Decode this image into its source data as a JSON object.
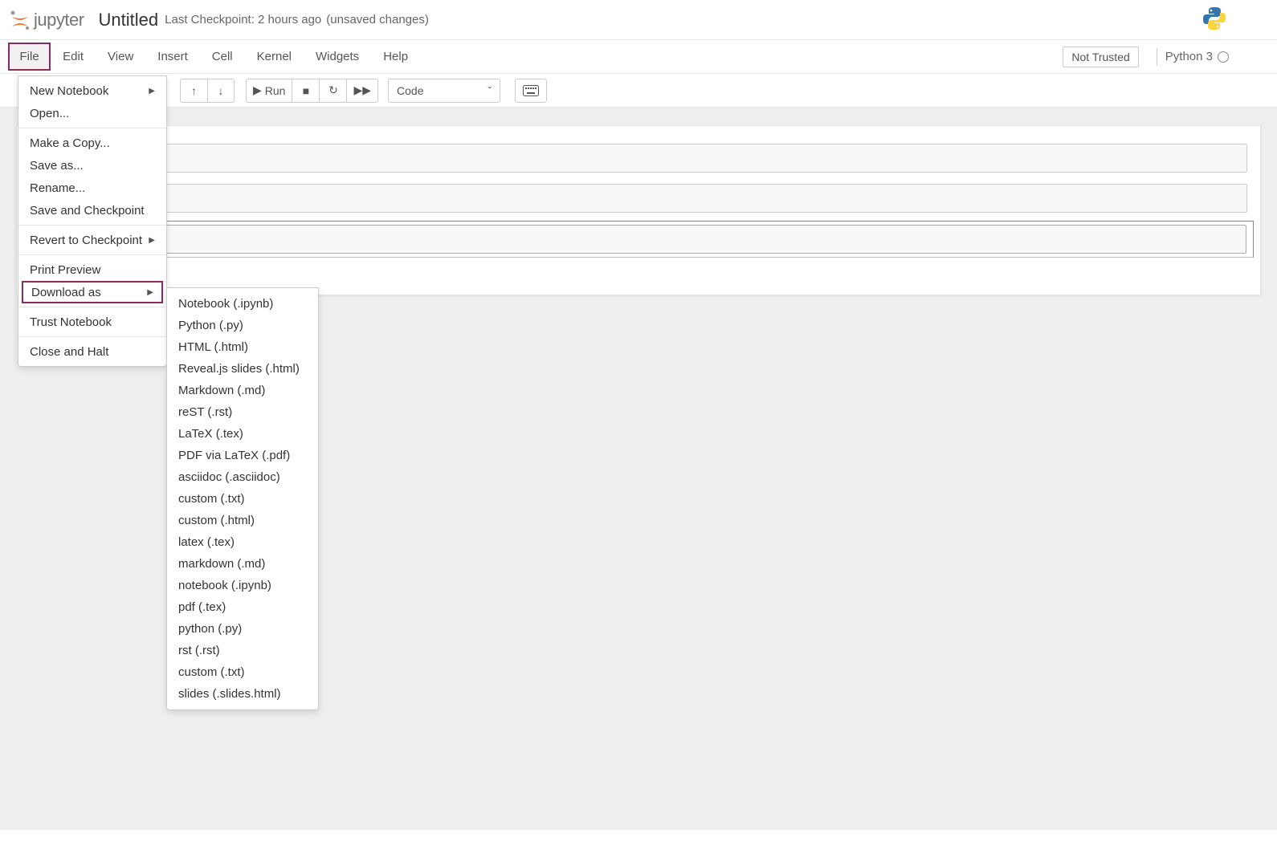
{
  "header": {
    "logo_text": "jupyter",
    "title": "Untitled",
    "checkpoint": "Last Checkpoint: 2 hours ago",
    "unsaved": "(unsaved changes)"
  },
  "menubar": {
    "items": [
      "File",
      "Edit",
      "View",
      "Insert",
      "Cell",
      "Kernel",
      "Widgets",
      "Help"
    ],
    "trust": "Not Trusted",
    "kernel": "Python 3"
  },
  "toolbar": {
    "run_label": "Run",
    "celltype": "Code"
  },
  "file_menu": {
    "items": [
      {
        "label": "New Notebook",
        "submenu": true
      },
      {
        "label": "Open..."
      },
      {
        "divider": true
      },
      {
        "label": "Make a Copy..."
      },
      {
        "label": "Save as..."
      },
      {
        "label": "Rename..."
      },
      {
        "label": "Save and Checkpoint"
      },
      {
        "divider": true
      },
      {
        "label": "Revert to Checkpoint",
        "submenu": true
      },
      {
        "divider": true
      },
      {
        "label": "Print Preview"
      },
      {
        "label": "Download as",
        "submenu": true,
        "boxed": true
      },
      {
        "divider": true
      },
      {
        "label": "Trust Notebook"
      },
      {
        "divider": true
      },
      {
        "label": "Close and Halt"
      }
    ]
  },
  "download_as_menu": {
    "items": [
      "Notebook (.ipynb)",
      "Python (.py)",
      "HTML (.html)",
      "Reveal.js slides (.html)",
      "Markdown (.md)",
      "reST (.rst)",
      "LaTeX (.tex)",
      "PDF via LaTeX (.pdf)",
      "asciidoc (.asciidoc)",
      "custom (.txt)",
      "custom (.html)",
      "latex (.tex)",
      "markdown (.md)",
      "notebook (.ipynb)",
      "pdf (.tex)",
      "python (.py)",
      "rst (.rst)",
      "custom (.txt)",
      "slides (.slides.html)"
    ]
  }
}
